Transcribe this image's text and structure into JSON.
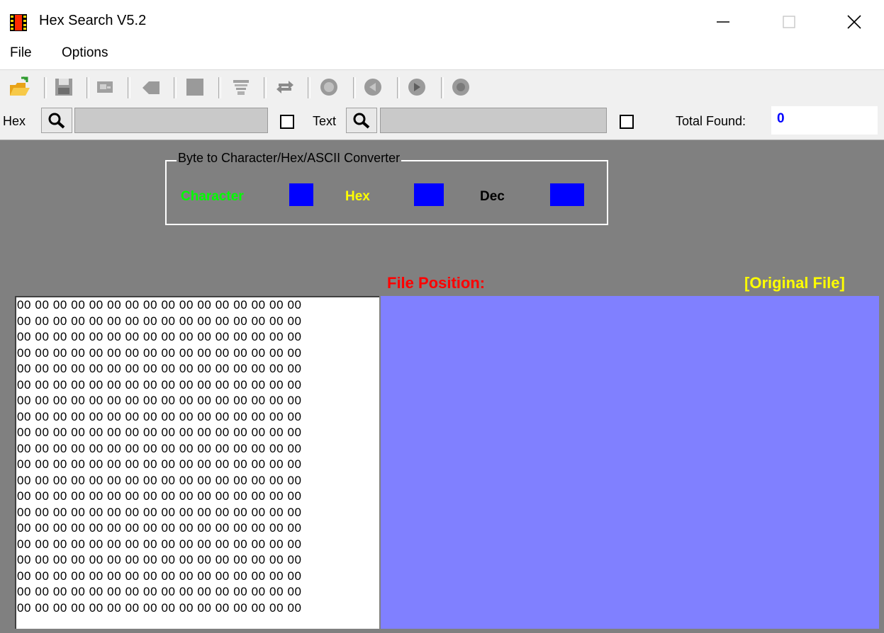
{
  "window": {
    "title": "Hex Search V5.2",
    "icon": "film-strip-icon"
  },
  "menu": {
    "items": [
      "File",
      "Options"
    ]
  },
  "toolbar": {
    "buttons": [
      {
        "name": "open-file",
        "icon": "open-folder-icon"
      },
      {
        "name": "save-file",
        "icon": "save-disk-icon"
      },
      {
        "name": "find",
        "icon": "find-icon"
      },
      {
        "name": "replace",
        "icon": "replace-icon"
      },
      {
        "name": "stop",
        "icon": "stop-icon"
      },
      {
        "name": "bytes",
        "icon": "bytes-icon"
      },
      {
        "name": "refresh",
        "icon": "refresh-icon"
      },
      {
        "name": "first",
        "icon": "first-icon"
      },
      {
        "name": "previous",
        "icon": "previous-icon"
      },
      {
        "name": "next",
        "icon": "next-icon"
      },
      {
        "name": "last",
        "icon": "last-icon"
      }
    ]
  },
  "search": {
    "hex_label": "Hex",
    "hex_value": "",
    "text_label": "Text",
    "text_value": "",
    "total_found_label": "Total Found:",
    "total_found_value": "0"
  },
  "converter": {
    "title": "Byte to Character/Hex/ASCII Converter",
    "character_label": "Character",
    "hex_label": "Hex",
    "dec_label": "Dec",
    "colors": {
      "character": "#00ff00",
      "hex": "#ffff00",
      "dec": "#000000",
      "box": "#0000ff"
    }
  },
  "view": {
    "file_position_label": "File Position:",
    "file_mode_label": "[Original File]",
    "hex_lines": [
      "00 00 00 00 00 00 00 00 00 00 00 00 00 00 00 00",
      "00 00 00 00 00 00 00 00 00 00 00 00 00 00 00 00",
      "00 00 00 00 00 00 00 00 00 00 00 00 00 00 00 00",
      "00 00 00 00 00 00 00 00 00 00 00 00 00 00 00 00",
      "00 00 00 00 00 00 00 00 00 00 00 00 00 00 00 00",
      "00 00 00 00 00 00 00 00 00 00 00 00 00 00 00 00",
      "00 00 00 00 00 00 00 00 00 00 00 00 00 00 00 00",
      "00 00 00 00 00 00 00 00 00 00 00 00 00 00 00 00",
      "00 00 00 00 00 00 00 00 00 00 00 00 00 00 00 00",
      "00 00 00 00 00 00 00 00 00 00 00 00 00 00 00 00",
      "00 00 00 00 00 00 00 00 00 00 00 00 00 00 00 00",
      "00 00 00 00 00 00 00 00 00 00 00 00 00 00 00 00",
      "00 00 00 00 00 00 00 00 00 00 00 00 00 00 00 00",
      "00 00 00 00 00 00 00 00 00 00 00 00 00 00 00 00",
      "00 00 00 00 00 00 00 00 00 00 00 00 00 00 00 00",
      "00 00 00 00 00 00 00 00 00 00 00 00 00 00 00 00",
      "00 00 00 00 00 00 00 00 00 00 00 00 00 00 00 00",
      "00 00 00 00 00 00 00 00 00 00 00 00 00 00 00 00",
      "00 00 00 00 00 00 00 00 00 00 00 00 00 00 00 00",
      "00 00 00 00 00 00 00 00 00 00 00 00 00 00 00 00"
    ],
    "ascii_panel_color": "#8080ff"
  }
}
